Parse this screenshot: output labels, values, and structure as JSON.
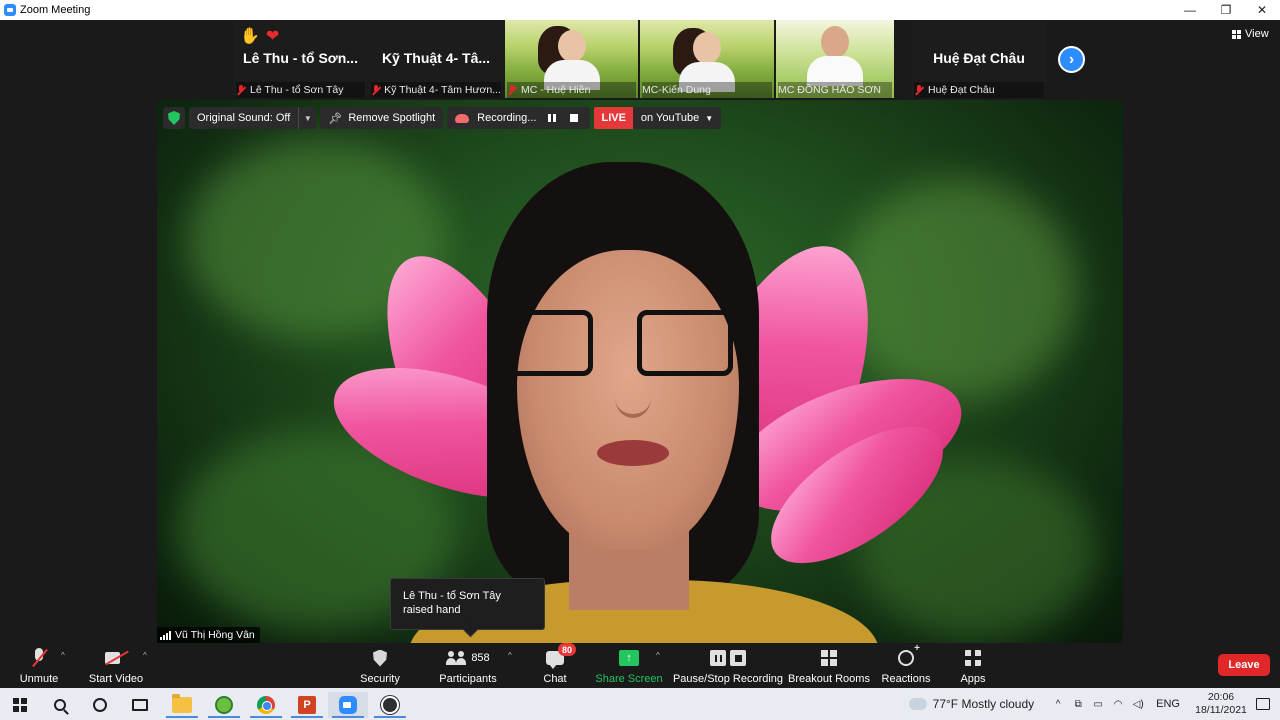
{
  "window": {
    "title": "Zoom Meeting",
    "controls": [
      "—",
      "❐",
      "✕"
    ]
  },
  "strip": {
    "tiles": [
      {
        "big_name": "Lê Thu - tổ Sơn...",
        "label": "Lê Thu - tổ Sơn Tây",
        "muted": true,
        "reactions": [
          "✋",
          "❤"
        ]
      },
      {
        "big_name": "Kỹ Thuật 4- Tâ...",
        "label": "Kỹ Thuật 4- Tâm Hươn...",
        "muted": true
      },
      {
        "label": "MC - Huệ Hiền",
        "muted": true,
        "video": true
      },
      {
        "label": "MC-Kiến Dung",
        "muted": false,
        "video": true
      },
      {
        "label": "MC ĐỒNG HẢO SƠN",
        "muted": false,
        "video": true
      },
      {
        "big_name": "Huệ Đạt Châu",
        "label": "Huệ Đạt Châu",
        "muted": true
      }
    ],
    "next_glyph": "›",
    "view_label": "View"
  },
  "meeting_bar": {
    "original_sound": "Original Sound: Off",
    "remove_spotlight": "Remove Spotlight",
    "recording": "Recording...",
    "live": "LIVE",
    "live_destination": "on YouTube"
  },
  "speaker": {
    "name": "Vũ Thị Hồng Vân"
  },
  "toast": {
    "text": "Lê Thu - tổ Sơn Tây raised hand"
  },
  "toolbar": {
    "unmute": "Unmute",
    "start_video": "Start Video",
    "security": "Security",
    "participants": "Participants",
    "participants_count": "858",
    "chat": "Chat",
    "chat_badge": "80",
    "share_screen": "Share Screen",
    "pause_stop_recording": "Pause/Stop Recording",
    "breakout_rooms": "Breakout Rooms",
    "reactions": "Reactions",
    "apps": "Apps",
    "leave": "Leave",
    "share_glyph": "↑"
  },
  "taskbar": {
    "ppt_letter": "P",
    "weather": "77°F  Mostly cloudy",
    "language": "ENG",
    "time": "20:06",
    "date": "18/11/2021",
    "tray_glyphs": [
      "^",
      "⧉",
      "▭",
      "◠",
      "◁)"
    ]
  },
  "colors": {
    "zoom_blue": "#2d8cff",
    "live_red": "#e5383b",
    "share_green": "#23c55e",
    "leave_red": "#e02828"
  }
}
